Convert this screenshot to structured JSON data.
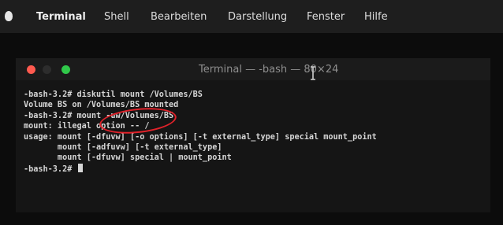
{
  "menubar": {
    "items": [
      "Terminal",
      "Shell",
      "Bearbeiten",
      "Darstellung",
      "Fenster",
      "Hilfe"
    ]
  },
  "window": {
    "title": "Terminal — -bash — 80×24"
  },
  "terminal": {
    "lines": [
      "-bash-3.2# diskutil mount /Volumes/BS",
      "Volume BS on /Volumes/BS mounted",
      "-bash-3.2# mount -uw/Volumes/BS",
      "mount: illegal option -- /",
      "usage: mount [-dfuvw] [-o options] [-t external_type] special mount_point",
      "       mount [-adfuvw] [-t external_type]",
      "       mount [-dfuvw] special | mount_point"
    ],
    "prompt": "-bash-3.2#"
  },
  "colors": {
    "annotation": "#e0222a",
    "close": "#ff5a4f",
    "maximize": "#30c84a"
  }
}
